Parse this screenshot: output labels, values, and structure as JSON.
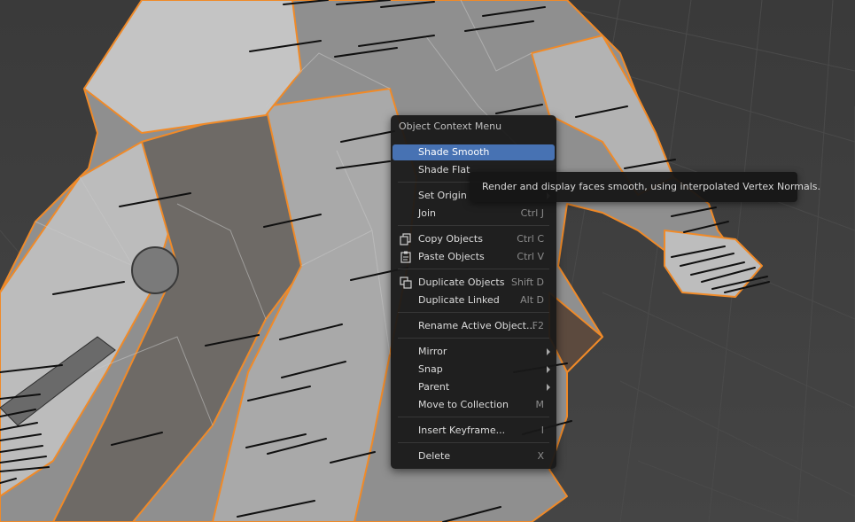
{
  "menu": {
    "title": "Object Context Menu",
    "items": [
      {
        "label": "Shade Smooth",
        "shortcut": "",
        "active": true
      },
      {
        "label": "Shade Flat",
        "shortcut": ""
      },
      {
        "label": "Set Origin",
        "shortcut": "",
        "submenu": true
      },
      {
        "label": "Join",
        "shortcut": "Ctrl J"
      },
      {
        "label": "Copy Objects",
        "shortcut": "Ctrl C",
        "icon": "copy-icon"
      },
      {
        "label": "Paste Objects",
        "shortcut": "Ctrl V",
        "icon": "paste-icon"
      },
      {
        "label": "Duplicate Objects",
        "shortcut": "Shift D",
        "icon": "duplicate-icon"
      },
      {
        "label": "Duplicate Linked",
        "shortcut": "Alt D"
      },
      {
        "label": "Rename Active Object...",
        "shortcut": "F2"
      },
      {
        "label": "Mirror",
        "shortcut": "",
        "submenu": true
      },
      {
        "label": "Snap",
        "shortcut": "",
        "submenu": true
      },
      {
        "label": "Parent",
        "shortcut": "",
        "submenu": true
      },
      {
        "label": "Move to Collection",
        "shortcut": "M"
      },
      {
        "label": "Insert Keyframe...",
        "shortcut": "I"
      },
      {
        "label": "Delete",
        "shortcut": "X"
      }
    ]
  },
  "tooltip": {
    "text": "Render and display faces smooth, using interpolated Vertex Normals."
  },
  "colors": {
    "highlight": "#4772b3",
    "selection_outline": "#f08a28",
    "background": "#3d3d3d"
  }
}
